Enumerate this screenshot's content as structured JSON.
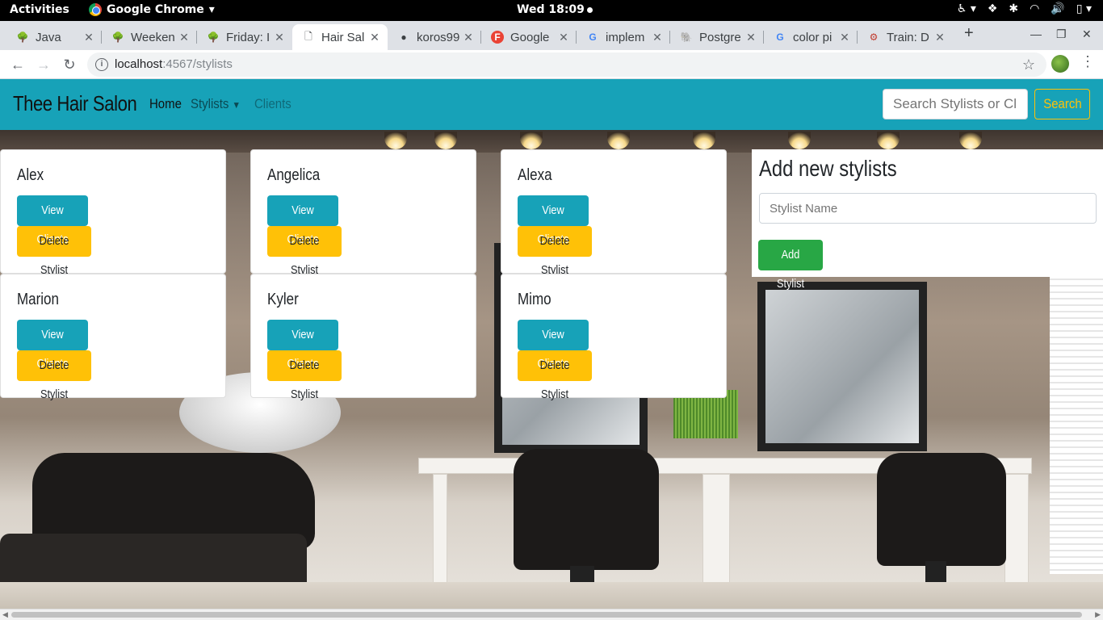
{
  "system": {
    "activities": "Activities",
    "app_name": "Google Chrome",
    "clock": "Wed 18:09"
  },
  "browser": {
    "tabs": [
      {
        "title": "Java",
        "favicon": "tree-icon"
      },
      {
        "title": "Weeken",
        "favicon": "tree-icon"
      },
      {
        "title": "Friday: I",
        "favicon": "tree-icon"
      },
      {
        "title": "Hair Sal",
        "favicon": "page-icon",
        "active": true
      },
      {
        "title": "koros99",
        "favicon": "github-icon"
      },
      {
        "title": "Google",
        "favicon": "fonts-icon"
      },
      {
        "title": "implem",
        "favicon": "google-icon"
      },
      {
        "title": "Postgre",
        "favicon": "elephant-icon"
      },
      {
        "title": "color pi",
        "favicon": "google-icon"
      },
      {
        "title": "Train: D",
        "favicon": "train-icon"
      }
    ],
    "url_host": "localhost",
    "url_path": ":4567/stylists"
  },
  "navbar": {
    "brand": "Thee Hair Salon",
    "home": "Home",
    "stylists": "Stylists",
    "clients": "Clients",
    "search_placeholder": "Search Stylists or Clients",
    "search_button": "Search"
  },
  "stylists": [
    {
      "name": "Alex"
    },
    {
      "name": "Angelica"
    },
    {
      "name": "Alexa"
    },
    {
      "name": "Marion"
    },
    {
      "name": "Kyler"
    },
    {
      "name": "Mimo"
    }
  ],
  "card_buttons": {
    "view": "View Clients",
    "delete": "Delete Stylist"
  },
  "add_form": {
    "heading": "Add new stylists",
    "placeholder": "Stylist Name",
    "submit": "Add Stylist"
  },
  "colors": {
    "primary": "#17a2b8",
    "warning": "#ffc107",
    "success": "#28a745"
  }
}
